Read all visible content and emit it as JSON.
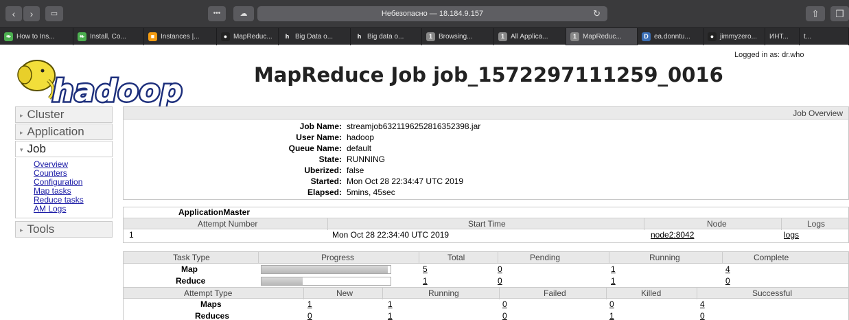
{
  "browser": {
    "address": "Небезопасно — 18.184.9.157",
    "tabs": [
      {
        "label": "How to Ins...",
        "icon": "green-leaf-icon",
        "color": "#4caf50",
        "glyph": "❧"
      },
      {
        "label": "Install, Co...",
        "icon": "green-leaf-icon",
        "color": "#4caf50",
        "glyph": "❧"
      },
      {
        "label": "Instances |...",
        "icon": "aws-cube-icon",
        "color": "#f39c12",
        "glyph": "■"
      },
      {
        "label": "MapReduc...",
        "icon": "github-icon",
        "color": "#222",
        "glyph": "●"
      },
      {
        "label": "Big Data o...",
        "icon": "h-icon",
        "color": "#2c2c2e",
        "glyph": "h"
      },
      {
        "label": "Big data o...",
        "icon": "h-icon",
        "color": "#2c2c2e",
        "glyph": "h"
      },
      {
        "label": "Browsing...",
        "icon": "one-badge-icon",
        "color": "#888",
        "glyph": "1"
      },
      {
        "label": "All Applica...",
        "icon": "one-badge-icon",
        "color": "#888",
        "glyph": "1"
      },
      {
        "label": "MapReduc...",
        "icon": "one-badge-icon",
        "color": "#888",
        "glyph": "1"
      },
      {
        "label": "ea.donntu...",
        "icon": "d-icon",
        "color": "#3b6fb6",
        "glyph": "D"
      },
      {
        "label": "jimmyzero...",
        "icon": "github-icon",
        "color": "#222",
        "glyph": "●"
      },
      {
        "label": "ИНТ...",
        "icon": "",
        "color": "#2c2c2e",
        "glyph": ""
      },
      {
        "label": "t...",
        "icon": "",
        "color": "#2c2c2e",
        "glyph": ""
      }
    ]
  },
  "header": {
    "logo_text": "hadoop",
    "title": "MapReduce Job job_1572297111259_0016",
    "logged_in": "Logged in as: dr.who"
  },
  "sidebar": {
    "cluster": "Cluster",
    "application": "Application",
    "job": "Job",
    "job_links": [
      "Overview",
      "Counters",
      "Configuration",
      "Map tasks",
      "Reduce tasks",
      "AM Logs"
    ],
    "tools": "Tools"
  },
  "overview": {
    "header": "Job Overview",
    "rows": [
      {
        "k": "Job Name:",
        "v": "streamjob6321196252816352398.jar"
      },
      {
        "k": "User Name:",
        "v": "hadoop"
      },
      {
        "k": "Queue Name:",
        "v": "default"
      },
      {
        "k": "State:",
        "v": "RUNNING"
      },
      {
        "k": "Uberized:",
        "v": "false"
      },
      {
        "k": "Started:",
        "v": "Mon Oct 28 22:34:47 UTC 2019"
      },
      {
        "k": "Elapsed:",
        "v": "5mins, 45sec"
      }
    ]
  },
  "am": {
    "title": "ApplicationMaster",
    "cols": [
      "Attempt Number",
      "Start Time",
      "Node",
      "Logs"
    ],
    "row": {
      "attempt": "1",
      "start": "Mon Oct 28 22:34:40 UTC 2019",
      "node": "node2:8042",
      "logs": "logs"
    }
  },
  "tasks": {
    "cols": [
      "Task Type",
      "Progress",
      "Total",
      "Pending",
      "Running",
      "Complete"
    ],
    "rows": [
      {
        "type": "Map",
        "progress": 0.98,
        "total": "5",
        "pending": "0",
        "running": "1",
        "complete": "4"
      },
      {
        "type": "Reduce",
        "progress": 0.32,
        "total": "1",
        "pending": "0",
        "running": "1",
        "complete": "0"
      }
    ],
    "attempt_cols": [
      "Attempt Type",
      "New",
      "Running",
      "Failed",
      "Killed",
      "Successful"
    ],
    "attempt_rows": [
      {
        "type": "Maps",
        "new": "1",
        "running": "1",
        "failed": "0",
        "killed": "0",
        "successful": "4"
      },
      {
        "type": "Reduces",
        "new": "0",
        "running": "1",
        "failed": "0",
        "killed": "1",
        "successful": "0"
      }
    ]
  }
}
